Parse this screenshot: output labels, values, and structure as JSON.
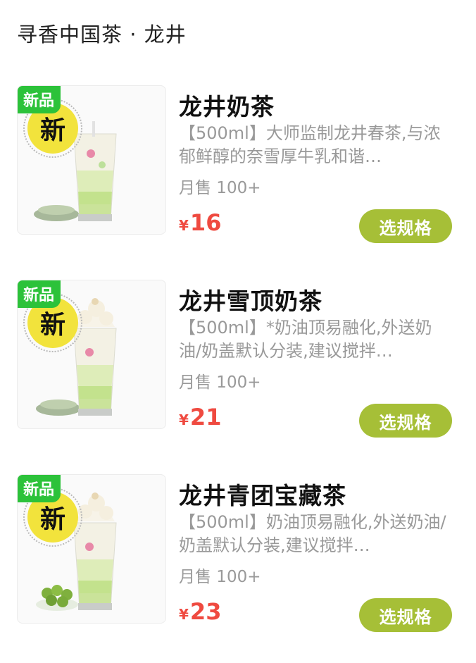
{
  "section": {
    "title": "寻香中国茶 · 龙井"
  },
  "products": [
    {
      "badge": "新品",
      "seal": "新",
      "name": "龙井奶茶",
      "desc": "【500ml】大师监制龙井春茶,与浓郁鲜醇的奈雪厚牛乳和谐…",
      "sales": "月售 100+",
      "currency": "¥",
      "price": "16",
      "button": "选规格"
    },
    {
      "badge": "新品",
      "seal": "新",
      "name": "龙井雪顶奶茶",
      "desc": "【500ml】*奶油顶易融化,外送奶油/奶盖默认分装,建议搅拌…",
      "sales": "月售 100+",
      "currency": "¥",
      "price": "21",
      "button": "选规格"
    },
    {
      "badge": "新品",
      "seal": "新",
      "name": "龙井青团宝藏茶",
      "desc": "【500ml】奶油顶易融化,外送奶油/奶盖默认分装,建议搅拌…",
      "sales": "月售 100+",
      "currency": "¥",
      "price": "23",
      "button": "选规格"
    }
  ],
  "colors": {
    "badge": "#2cc23a",
    "seal": "#f2e33c",
    "price": "#ef4a40",
    "button": "#a6bf37"
  }
}
